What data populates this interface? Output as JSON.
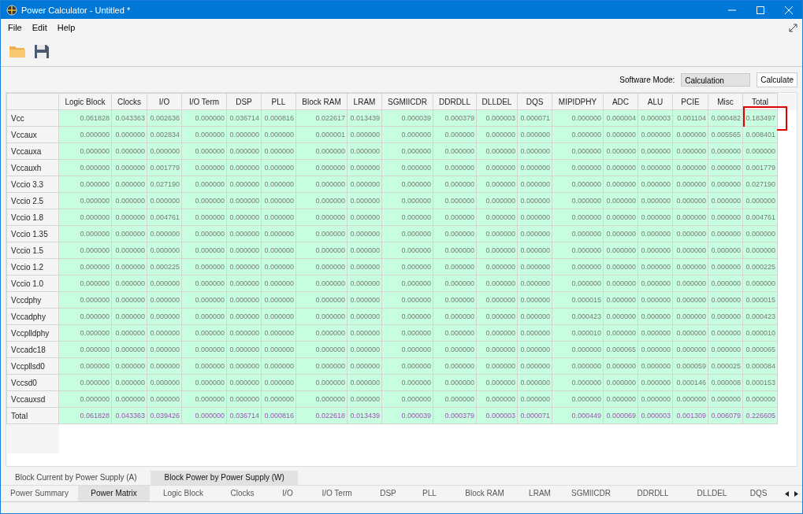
{
  "window": {
    "title": "Power Calculator - Untitled *"
  },
  "menu": [
    "File",
    "Edit",
    "Help"
  ],
  "mode": {
    "label": "Software Mode:",
    "value": "Calculation",
    "button": "Calculate"
  },
  "table": {
    "columns": [
      "Logic Block",
      "Clocks",
      "I/O",
      "I/O Term",
      "DSP",
      "PLL",
      "Block RAM",
      "LRAM",
      "SGMIICDR",
      "DDRDLL",
      "DLLDEL",
      "DQS",
      "MIPIDPHY",
      "ADC",
      "ALU",
      "PCIE",
      "Misc",
      "Total"
    ],
    "rows": [
      {
        "label": "Vcc",
        "kind": "supply",
        "total_highlighted": true,
        "cells": [
          "0.061828",
          "0.043363",
          "0.002636",
          "0.000000",
          "0.036714",
          "0.000816",
          "0.022617",
          "0.013439",
          "0.000039",
          "0.000379",
          "0.000003",
          "0.000071",
          "0.000000",
          "0.000004",
          "0.000003",
          "0.001104",
          "0.000482",
          "0.183497"
        ]
      },
      {
        "label": "Vccaux",
        "kind": "supply",
        "total_highlighted": false,
        "cells": [
          "0.000000",
          "0.000000",
          "0.002834",
          "0.000000",
          "0.000000",
          "0.000000",
          "0.000001",
          "0.000000",
          "0.000000",
          "0.000000",
          "0.000000",
          "0.000000",
          "0.000000",
          "0.000000",
          "0.000000",
          "0.000000",
          "0.005565",
          "0.008401"
        ]
      },
      {
        "label": "Vccauxa",
        "kind": "supply",
        "total_highlighted": false,
        "cells": [
          "0.000000",
          "0.000000",
          "0.000000",
          "0.000000",
          "0.000000",
          "0.000000",
          "0.000000",
          "0.000000",
          "0.000000",
          "0.000000",
          "0.000000",
          "0.000000",
          "0.000000",
          "0.000000",
          "0.000000",
          "0.000000",
          "0.000000",
          "0.000000"
        ]
      },
      {
        "label": "Vccauxh",
        "kind": "supply",
        "total_highlighted": false,
        "cells": [
          "0.000000",
          "0.000000",
          "0.001779",
          "0.000000",
          "0.000000",
          "0.000000",
          "0.000000",
          "0.000000",
          "0.000000",
          "0.000000",
          "0.000000",
          "0.000000",
          "0.000000",
          "0.000000",
          "0.000000",
          "0.000000",
          "0.000000",
          "0.001779"
        ]
      },
      {
        "label": "Vccio 3.3",
        "kind": "supply",
        "total_highlighted": false,
        "cells": [
          "0.000000",
          "0.000000",
          "0.027190",
          "0.000000",
          "0.000000",
          "0.000000",
          "0.000000",
          "0.000000",
          "0.000000",
          "0.000000",
          "0.000000",
          "0.000000",
          "0.000000",
          "0.000000",
          "0.000000",
          "0.000000",
          "0.000000",
          "0.027190"
        ]
      },
      {
        "label": "Vccio 2.5",
        "kind": "supply",
        "total_highlighted": false,
        "cells": [
          "0.000000",
          "0.000000",
          "0.000000",
          "0.000000",
          "0.000000",
          "0.000000",
          "0.000000",
          "0.000000",
          "0.000000",
          "0.000000",
          "0.000000",
          "0.000000",
          "0.000000",
          "0.000000",
          "0.000000",
          "0.000000",
          "0.000000",
          "0.000000"
        ]
      },
      {
        "label": "Vccio 1.8",
        "kind": "supply",
        "total_highlighted": false,
        "cells": [
          "0.000000",
          "0.000000",
          "0.004761",
          "0.000000",
          "0.000000",
          "0.000000",
          "0.000000",
          "0.000000",
          "0.000000",
          "0.000000",
          "0.000000",
          "0.000000",
          "0.000000",
          "0.000000",
          "0.000000",
          "0.000000",
          "0.000000",
          "0.004761"
        ]
      },
      {
        "label": "Vccio 1.35",
        "kind": "supply",
        "total_highlighted": false,
        "cells": [
          "0.000000",
          "0.000000",
          "0.000000",
          "0.000000",
          "0.000000",
          "0.000000",
          "0.000000",
          "0.000000",
          "0.000000",
          "0.000000",
          "0.000000",
          "0.000000",
          "0.000000",
          "0.000000",
          "0.000000",
          "0.000000",
          "0.000000",
          "0.000000"
        ]
      },
      {
        "label": "Vccio 1.5",
        "kind": "supply",
        "total_highlighted": false,
        "cells": [
          "0.000000",
          "0.000000",
          "0.000000",
          "0.000000",
          "0.000000",
          "0.000000",
          "0.000000",
          "0.000000",
          "0.000000",
          "0.000000",
          "0.000000",
          "0.000000",
          "0.000000",
          "0.000000",
          "0.000000",
          "0.000000",
          "0.000000",
          "0.000000"
        ]
      },
      {
        "label": "Vccio 1.2",
        "kind": "supply",
        "total_highlighted": false,
        "cells": [
          "0.000000",
          "0.000000",
          "0.000225",
          "0.000000",
          "0.000000",
          "0.000000",
          "0.000000",
          "0.000000",
          "0.000000",
          "0.000000",
          "0.000000",
          "0.000000",
          "0.000000",
          "0.000000",
          "0.000000",
          "0.000000",
          "0.000000",
          "0.000225"
        ]
      },
      {
        "label": "Vccio 1.0",
        "kind": "supply",
        "total_highlighted": false,
        "cells": [
          "0.000000",
          "0.000000",
          "0.000000",
          "0.000000",
          "0.000000",
          "0.000000",
          "0.000000",
          "0.000000",
          "0.000000",
          "0.000000",
          "0.000000",
          "0.000000",
          "0.000000",
          "0.000000",
          "0.000000",
          "0.000000",
          "0.000000",
          "0.000000"
        ]
      },
      {
        "label": "Vccdphy",
        "kind": "supply",
        "total_highlighted": false,
        "cells": [
          "0.000000",
          "0.000000",
          "0.000000",
          "0.000000",
          "0.000000",
          "0.000000",
          "0.000000",
          "0.000000",
          "0.000000",
          "0.000000",
          "0.000000",
          "0.000000",
          "0.000015",
          "0.000000",
          "0.000000",
          "0.000000",
          "0.000000",
          "0.000015"
        ]
      },
      {
        "label": "Vccadphy",
        "kind": "supply",
        "total_highlighted": false,
        "cells": [
          "0.000000",
          "0.000000",
          "0.000000",
          "0.000000",
          "0.000000",
          "0.000000",
          "0.000000",
          "0.000000",
          "0.000000",
          "0.000000",
          "0.000000",
          "0.000000",
          "0.000423",
          "0.000000",
          "0.000000",
          "0.000000",
          "0.000000",
          "0.000423"
        ]
      },
      {
        "label": "Vccplldphy",
        "kind": "supply",
        "total_highlighted": false,
        "cells": [
          "0.000000",
          "0.000000",
          "0.000000",
          "0.000000",
          "0.000000",
          "0.000000",
          "0.000000",
          "0.000000",
          "0.000000",
          "0.000000",
          "0.000000",
          "0.000000",
          "0.000010",
          "0.000000",
          "0.000000",
          "0.000000",
          "0.000000",
          "0.000010"
        ]
      },
      {
        "label": "Vccadc18",
        "kind": "supply",
        "total_highlighted": false,
        "cells": [
          "0.000000",
          "0.000000",
          "0.000000",
          "0.000000",
          "0.000000",
          "0.000000",
          "0.000000",
          "0.000000",
          "0.000000",
          "0.000000",
          "0.000000",
          "0.000000",
          "0.000000",
          "0.000065",
          "0.000000",
          "0.000000",
          "0.000000",
          "0.000065"
        ]
      },
      {
        "label": "Vccpllsd0",
        "kind": "supply",
        "total_highlighted": false,
        "cells": [
          "0.000000",
          "0.000000",
          "0.000000",
          "0.000000",
          "0.000000",
          "0.000000",
          "0.000000",
          "0.000000",
          "0.000000",
          "0.000000",
          "0.000000",
          "0.000000",
          "0.000000",
          "0.000000",
          "0.000000",
          "0.000059",
          "0.000025",
          "0.000084"
        ]
      },
      {
        "label": "Vccsd0",
        "kind": "supply",
        "total_highlighted": false,
        "cells": [
          "0.000000",
          "0.000000",
          "0.000000",
          "0.000000",
          "0.000000",
          "0.000000",
          "0.000000",
          "0.000000",
          "0.000000",
          "0.000000",
          "0.000000",
          "0.000000",
          "0.000000",
          "0.000000",
          "0.000000",
          "0.000146",
          "0.000008",
          "0.000153"
        ]
      },
      {
        "label": "Vccauxsd",
        "kind": "supply",
        "total_highlighted": false,
        "cells": [
          "0.000000",
          "0.000000",
          "0.000000",
          "0.000000",
          "0.000000",
          "0.000000",
          "0.000000",
          "0.000000",
          "0.000000",
          "0.000000",
          "0.000000",
          "0.000000",
          "0.000000",
          "0.000000",
          "0.000000",
          "0.000000",
          "0.000000",
          "0.000000"
        ]
      },
      {
        "label": "Total",
        "kind": "total",
        "total_highlighted": false,
        "cells": [
          "0.061828",
          "0.043363",
          "0.039426",
          "0.000000",
          "0.036714",
          "0.000816",
          "0.022618",
          "0.013439",
          "0.000039",
          "0.000379",
          "0.000003",
          "0.000071",
          "0.000449",
          "0.000069",
          "0.000003",
          "0.001309",
          "0.006079",
          "0.226605"
        ]
      }
    ]
  },
  "view_tabs": [
    {
      "label": "Block Current by Power Supply (A)",
      "selected": false
    },
    {
      "label": "Block Power by Power Supply (W)",
      "selected": true
    }
  ],
  "page_tabs": [
    {
      "label": "Power Summary",
      "selected": false
    },
    {
      "label": "Power Matrix",
      "selected": true
    },
    {
      "label": "Logic Block",
      "selected": false
    },
    {
      "label": "Clocks",
      "selected": false
    },
    {
      "label": "I/O",
      "selected": false
    },
    {
      "label": "I/O Term",
      "selected": false
    },
    {
      "label": "DSP",
      "selected": false
    },
    {
      "label": "PLL",
      "selected": false
    },
    {
      "label": "Block RAM",
      "selected": false
    },
    {
      "label": "LRAM",
      "selected": false
    },
    {
      "label": "SGMIICDR",
      "selected": false
    },
    {
      "label": "DDRDLL",
      "selected": false
    },
    {
      "label": "DLLDEL",
      "selected": false
    },
    {
      "label": "DQS",
      "selected": false
    }
  ]
}
